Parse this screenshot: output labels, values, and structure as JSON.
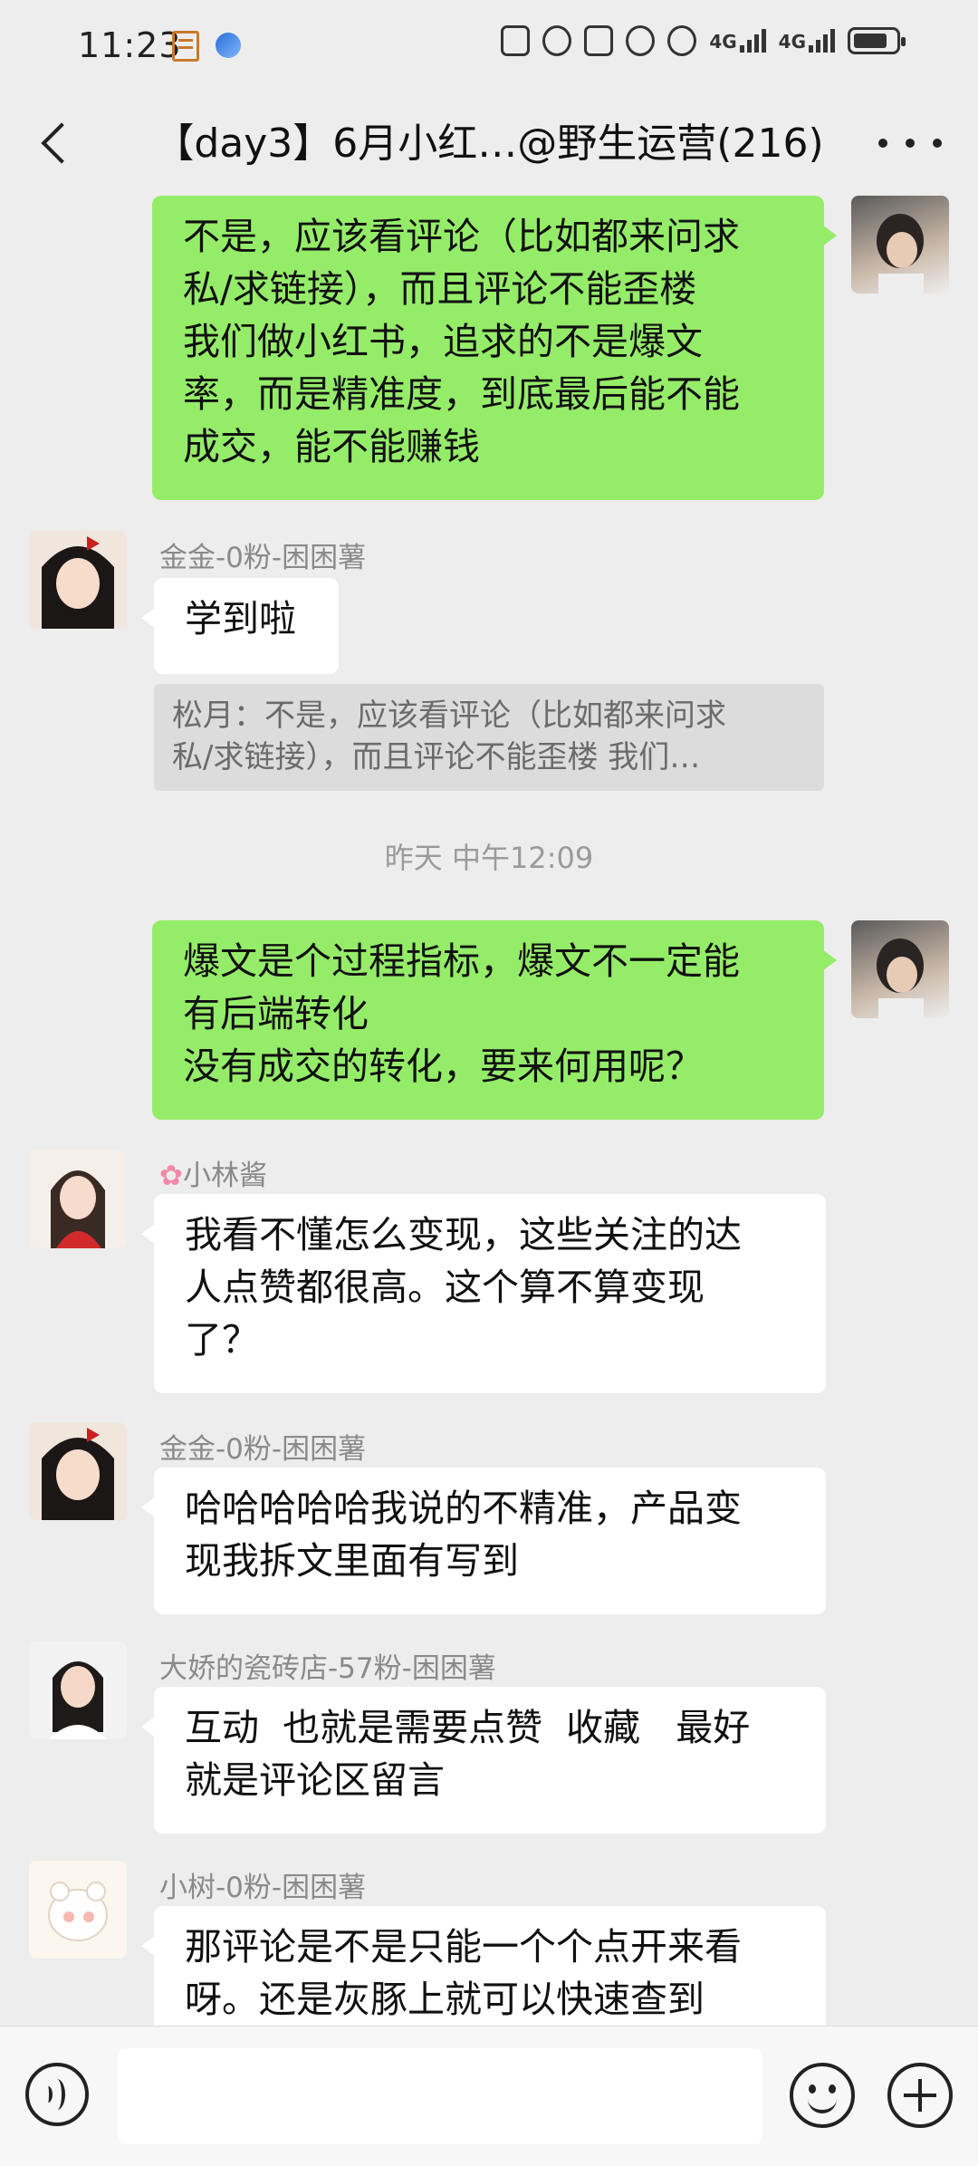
{
  "status_bar": {
    "time": "11:23",
    "net1": "4G",
    "net2": "4G"
  },
  "header": {
    "title": "【day3】6月小红…@野生运营(216)"
  },
  "messages": [
    {
      "side": "self",
      "lines": [
        "不是，应该看评论（比如都来问求",
        "私/求链接），而且评论不能歪楼",
        "我们做小红书，追求的不是爆文",
        "率，而是精准度，到底最后能不能",
        "成交，能不能赚钱"
      ]
    },
    {
      "side": "other",
      "sender": "金金-0粉-困困薯",
      "lines": [
        "学到啦"
      ]
    },
    {
      "side": "self",
      "lines": [
        "爆文是个过程指标，爆文不一定能",
        "有后端转化",
        "没有成交的转化，要来何用呢？"
      ]
    },
    {
      "side": "other",
      "sender": "小林酱",
      "lines": [
        "我看不懂怎么变现，这些关注的达",
        "人点赞都很高。这个算不算变现",
        "了？"
      ]
    },
    {
      "side": "other",
      "sender": "金金-0粉-困困薯",
      "lines": [
        "哈哈哈哈哈我说的不精准，产品变",
        "现我拆文里面有写到"
      ]
    },
    {
      "side": "other",
      "sender": "大娇的瓷砖店-57粉-困困薯",
      "lines": [
        "互动  也就是需要点赞  收藏   最好",
        "就是评论区留言"
      ]
    },
    {
      "side": "other",
      "sender": "小树-0粉-困困薯",
      "lines": [
        "那评论是不是只能一个个点开来看",
        "呀。还是灰豚上就可以快速查到"
      ]
    }
  ],
  "quote": {
    "lines": [
      "松月：不是，应该看评论（比如都来问求",
      "私/求链接），而且评论不能歪楼 我们…"
    ]
  },
  "timestamp": "昨天 中午12:09",
  "colors": {
    "self_bubble": "#95ec69",
    "other_bubble": "#ffffff",
    "background": "#ededed"
  }
}
